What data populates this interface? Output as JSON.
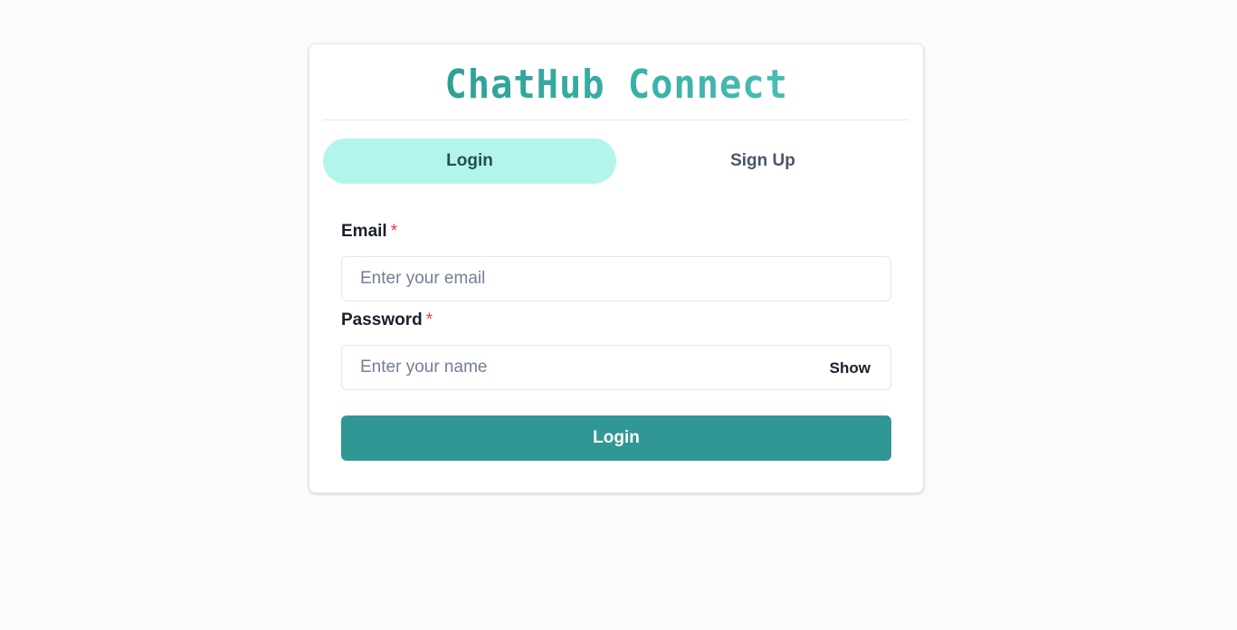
{
  "app": {
    "title": "ChatHub Connect"
  },
  "tabs": [
    {
      "label": "Login",
      "active": true
    },
    {
      "label": "Sign Up",
      "active": false
    }
  ],
  "form": {
    "email": {
      "label": "Email",
      "required_mark": "*",
      "placeholder": "Enter your email",
      "value": ""
    },
    "password": {
      "label": "Password",
      "required_mark": "*",
      "placeholder": "Enter your name",
      "value": "",
      "toggle_label": "Show"
    },
    "submit_label": "Login"
  },
  "colors": {
    "accent": "#319795",
    "tab_active_bg": "#b2f5ea",
    "required": "#e53e3e",
    "title_gradient": [
      "#2f9f94",
      "#46bdb5"
    ]
  }
}
